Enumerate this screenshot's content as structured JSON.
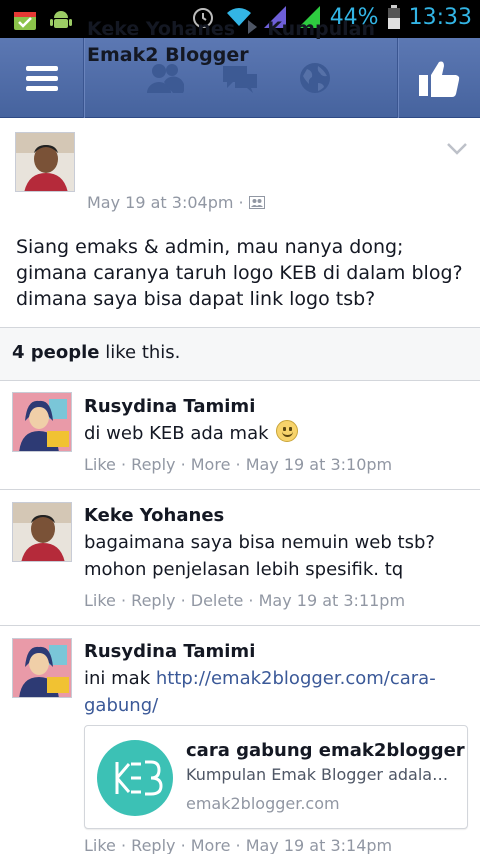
{
  "status_bar": {
    "battery_percent": "44%",
    "time": "13:33",
    "left_icons": [
      "store-icon",
      "android-icon"
    ],
    "right_icons": [
      "alarm-icon",
      "wifi-icon",
      "signal-icon",
      "signal-icon",
      "battery-icon"
    ]
  },
  "navbar": {
    "items": [
      "menu-icon",
      "friends-icon",
      "messages-icon",
      "globe-icon",
      "like-icon"
    ],
    "accent": "#4a66a0"
  },
  "post": {
    "author": "Keke Yohanes",
    "target_group": "Kumpulan Emak2 Blogger",
    "timestamp": "May 19 at 3:04pm",
    "text_lines": [
      "Siang emaks & admin, mau nanya dong;",
      "gimana caranya taruh logo KEB di dalam blog?",
      "dimana saya bisa dapat link logo tsb?"
    ],
    "likes_count": "4 people",
    "likes_suffix": " like this."
  },
  "comments": [
    {
      "author": "Rusydina Tamimi",
      "text": "di web KEB ada mak",
      "emoji": "☺",
      "actions": [
        "Like",
        "Reply",
        "More"
      ],
      "timestamp": "May 19 at 3:10pm"
    },
    {
      "author": "Keke Yohanes",
      "text_lines": [
        "bagaimana saya bisa nemuin web tsb?",
        "mohon penjelasan lebih spesifik. tq"
      ],
      "actions": [
        "Like",
        "Reply",
        "Delete"
      ],
      "timestamp": "May 19 at 3:11pm"
    },
    {
      "author": "Rusydina Tamimi",
      "text_prefix": "ini mak ",
      "url_line1": "http://emak2blogger.com/cara-",
      "url_line2": "gabung/",
      "card": {
        "title": "cara gabung emak2blogger",
        "description": "Kumpulan Emak Blogger adalah komunitas",
        "domain": "emak2blogger.com",
        "logo_text": "KEB",
        "logo_color": "#3cc1b5"
      },
      "actions": [
        "Like",
        "Reply",
        "More"
      ],
      "timestamp": "May 19 at 3:14pm"
    }
  ]
}
